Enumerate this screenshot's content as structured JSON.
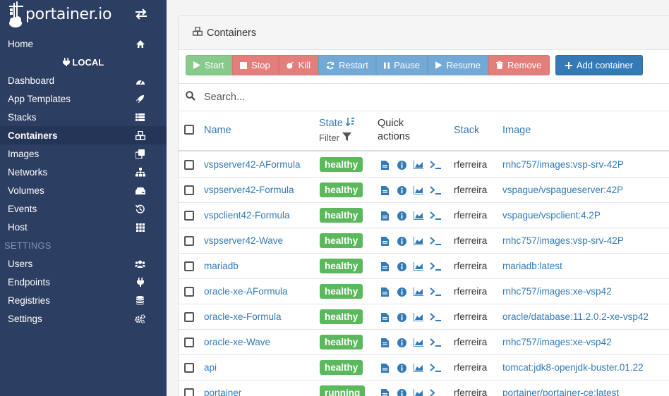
{
  "brand": {
    "name": "portainer.io"
  },
  "sidebar": {
    "home": {
      "label": "Home",
      "icon": "home-icon"
    },
    "endpoint": {
      "label": "LOCAL",
      "icon": "plug-icon"
    },
    "items": [
      {
        "label": "Dashboard",
        "icon": "dashboard-icon"
      },
      {
        "label": "App Templates",
        "icon": "rocket-icon"
      },
      {
        "label": "Stacks",
        "icon": "list-icon"
      },
      {
        "label": "Containers",
        "icon": "cubes-icon",
        "active": true
      },
      {
        "label": "Images",
        "icon": "clone-icon"
      },
      {
        "label": "Networks",
        "icon": "sitemap-icon"
      },
      {
        "label": "Volumes",
        "icon": "hdd-icon"
      },
      {
        "label": "Events",
        "icon": "history-icon"
      },
      {
        "label": "Host",
        "icon": "grid-icon"
      }
    ],
    "settings_heading": "SETTINGS",
    "settings_items": [
      {
        "label": "Users",
        "icon": "users-icon"
      },
      {
        "label": "Endpoints",
        "icon": "plug-icon"
      },
      {
        "label": "Registries",
        "icon": "database-icon"
      },
      {
        "label": "Settings",
        "icon": "cogs-icon"
      }
    ]
  },
  "panel": {
    "title": "Containers",
    "toolbar": {
      "start": "Start",
      "stop": "Stop",
      "kill": "Kill",
      "restart": "Restart",
      "pause": "Pause",
      "resume": "Resume",
      "remove": "Remove",
      "add": "Add container"
    },
    "search": {
      "placeholder": "Search..."
    },
    "columns": {
      "name": "Name",
      "state": "State",
      "filter": "Filter",
      "quick_actions_1": "Quick",
      "quick_actions_2": "actions",
      "stack": "Stack",
      "image": "Image"
    },
    "rows": [
      {
        "name": "vspserver42-AFormula",
        "state": "healthy",
        "stack": "rferreira",
        "image": "rnhc757/images:vsp-srv-42P"
      },
      {
        "name": "vspserver42-Formula",
        "state": "healthy",
        "stack": "rferreira",
        "image": "vspague/vspagueserver:42P"
      },
      {
        "name": "vspclient42-Formula",
        "state": "healthy",
        "stack": "rferreira",
        "image": "vspague/vspclient:4.2P"
      },
      {
        "name": "vspserver42-Wave",
        "state": "healthy",
        "stack": "rferreira",
        "image": "rnhc757/images:vsp-srv-42P"
      },
      {
        "name": "mariadb",
        "state": "healthy",
        "stack": "rferreira",
        "image": "mariadb:latest"
      },
      {
        "name": "oracle-xe-AFormula",
        "state": "healthy",
        "stack": "rferreira",
        "image": "rnhc757/images:xe-vsp42"
      },
      {
        "name": "oracle-xe-Formula",
        "state": "healthy",
        "stack": "rferreira",
        "image": "oracle/database:11.2.0.2-xe-vsp42"
      },
      {
        "name": "oracle-xe-Wave",
        "state": "healthy",
        "stack": "rferreira",
        "image": "rnhc757/images:xe-vsp42"
      },
      {
        "name": "api",
        "state": "healthy",
        "stack": "rferreira",
        "image": "tomcat:jdk8-openjdk-buster.01.22"
      },
      {
        "name": "portainer",
        "state": "running",
        "stack": "rferreira",
        "image": "portainer/portainer-ce:latest"
      }
    ]
  },
  "colors": {
    "sidebar_bg": "#2d3e63",
    "link": "#337ab7",
    "healthy": "#5cb85c",
    "start": "#88c98c",
    "danger": "#e37e7b",
    "info": "#73a9d6"
  }
}
